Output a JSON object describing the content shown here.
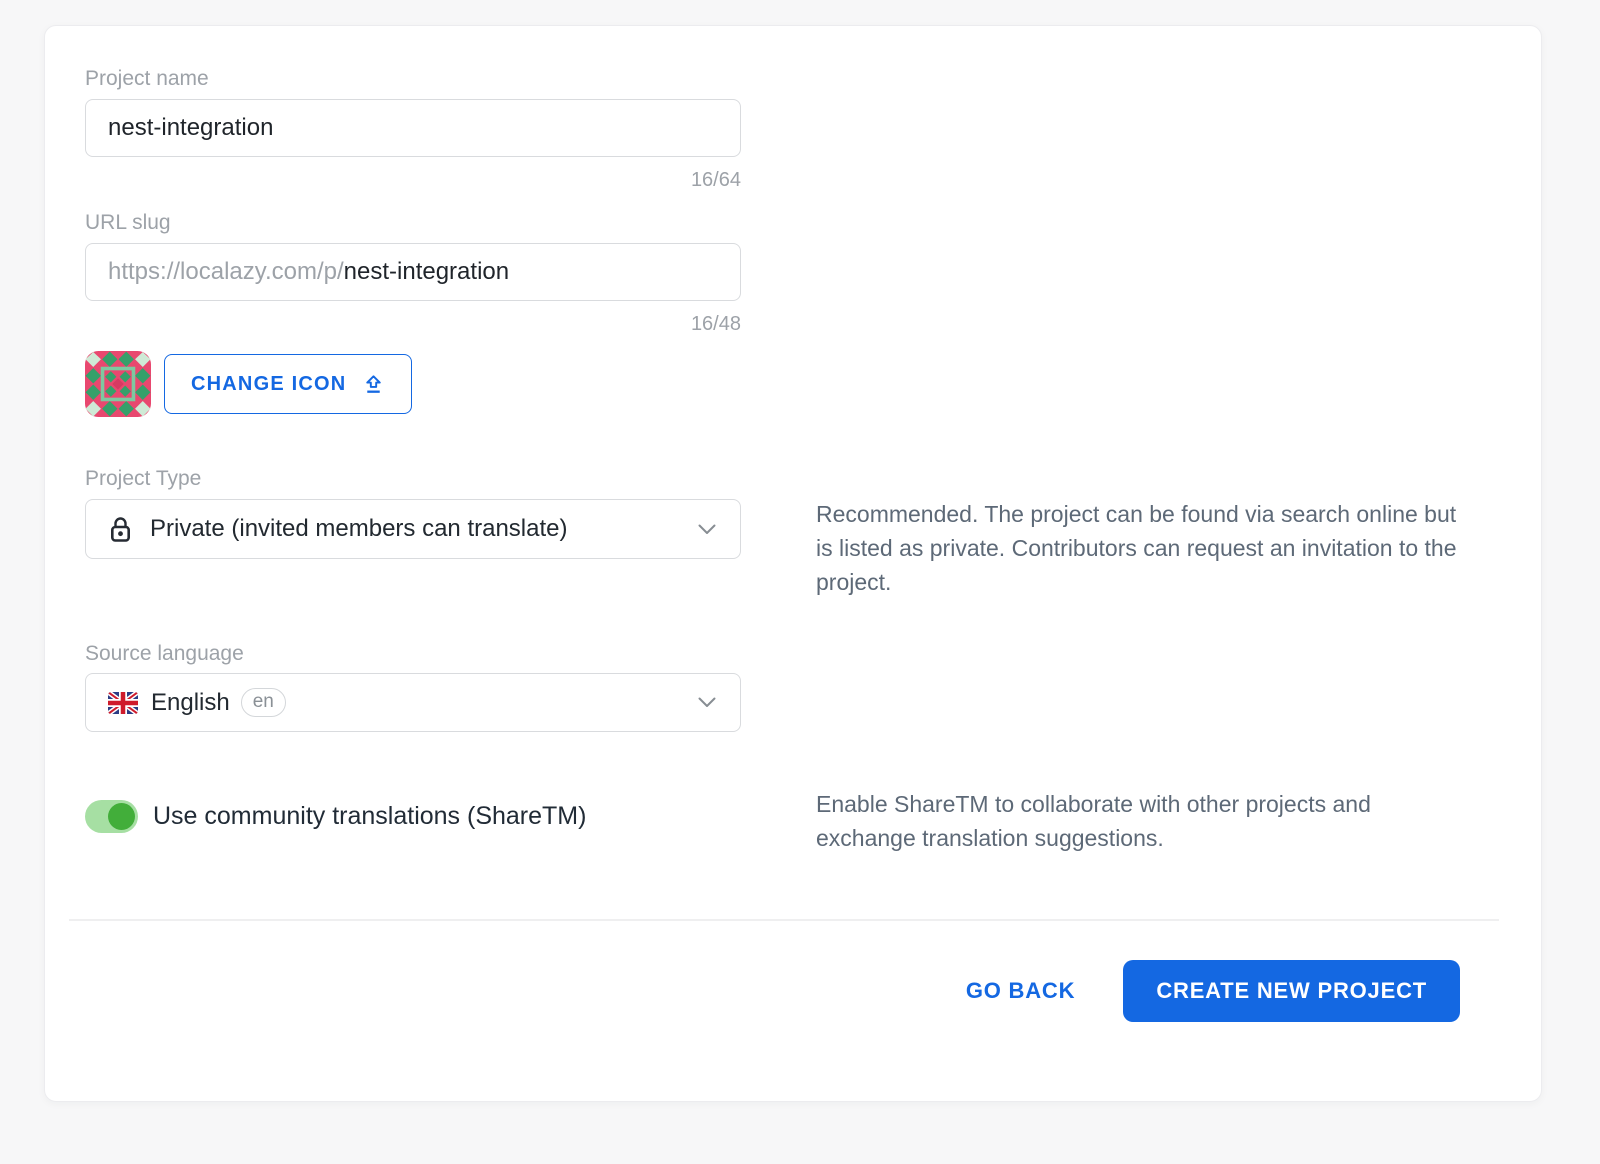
{
  "colors": {
    "accent_blue": "#1468e2",
    "page_bg": "#f7f7f8",
    "toggle_track": "#a6dfa3",
    "toggle_knob": "#42ae3a",
    "icon_bg": "#e8486f",
    "icon_green": "#35a06a",
    "icon_light_green": "#cfead6"
  },
  "form": {
    "project_name": {
      "label": "Project name",
      "value": "nest-integration",
      "counter": "16/64"
    },
    "url_slug": {
      "label": "URL slug",
      "prefix": "https://localazy.com/p/",
      "value": "nest-integration",
      "counter": "16/48"
    },
    "icon": {
      "change_button_label": "CHANGE ICON"
    },
    "project_type": {
      "label": "Project Type",
      "selected": "Private (invited members can translate)",
      "description": "Recommended. The project can be found via search online but is listed as private. Contributors can request an invitation to the project."
    },
    "source_language": {
      "label": "Source language",
      "selected": "English",
      "code": "en"
    },
    "sharetm": {
      "label": "Use community translations (ShareTM)",
      "enabled": true,
      "description": "Enable ShareTM to collaborate with other projects and exchange translation suggestions."
    }
  },
  "footer": {
    "go_back_label": "GO BACK",
    "create_label": "CREATE NEW PROJECT"
  }
}
